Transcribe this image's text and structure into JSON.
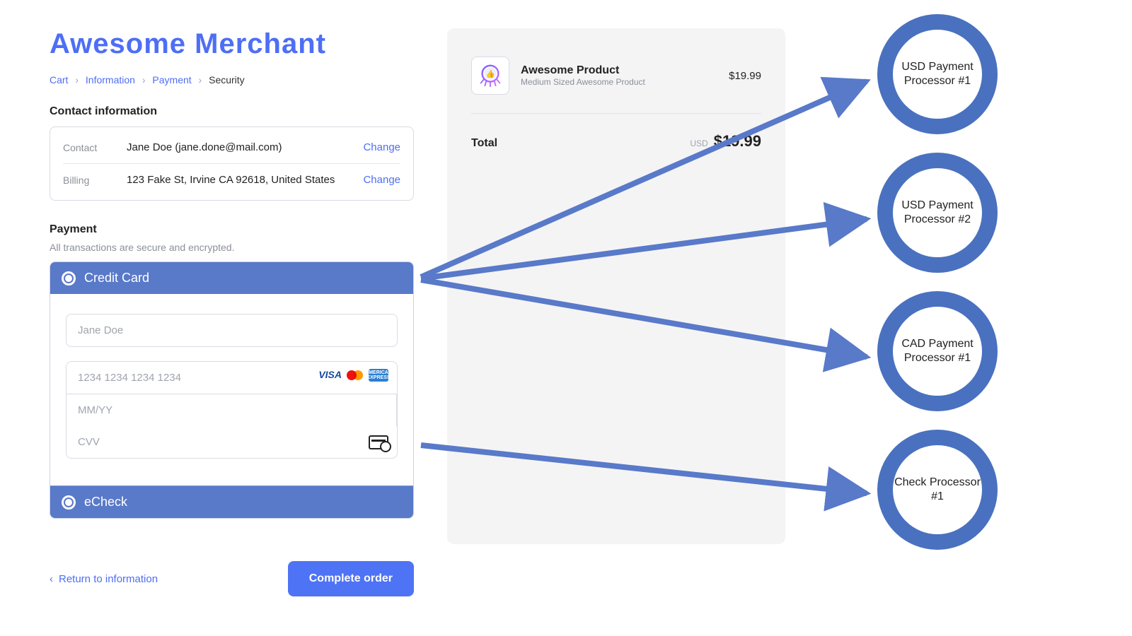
{
  "merchant": {
    "title": "Awesome Merchant"
  },
  "breadcrumb": {
    "cart": "Cart",
    "information": "Information",
    "payment": "Payment",
    "security": "Security"
  },
  "contact": {
    "section_label": "Contact information",
    "rows": {
      "contact_key": "Contact",
      "contact_val": "Jane Doe (jane.done@mail.com)",
      "billing_key": "Billing",
      "billing_val": "123 Fake St, Irvine CA 92618, United States"
    },
    "change_label": "Change"
  },
  "payment": {
    "section_label": "Payment",
    "subtext": "All transactions are secure and encrypted.",
    "method_credit": "Credit Card",
    "method_echeck": "eCheck",
    "name_placeholder": "Jane Doe",
    "card_placeholder": "1234 1234 1234 1234",
    "exp_placeholder": "MM/YY",
    "cvv_placeholder": "CVV",
    "brand_visa": "VISA",
    "brand_amex": "AMERICAN EXPRESS"
  },
  "actions": {
    "return_label": "Return to information",
    "complete_label": "Complete order"
  },
  "summary": {
    "item_name": "Awesome Product",
    "item_desc": "Medium Sized Awesome Product",
    "item_price": "$19.99",
    "total_label": "Total",
    "total_currency_label": "USD",
    "total_amount": "$19.99"
  },
  "processors": {
    "p1": "USD Payment Processor #1",
    "p2": "USD Payment Processor #2",
    "p3": "CAD Payment Processor #1",
    "p4": "Check Processor #1"
  }
}
